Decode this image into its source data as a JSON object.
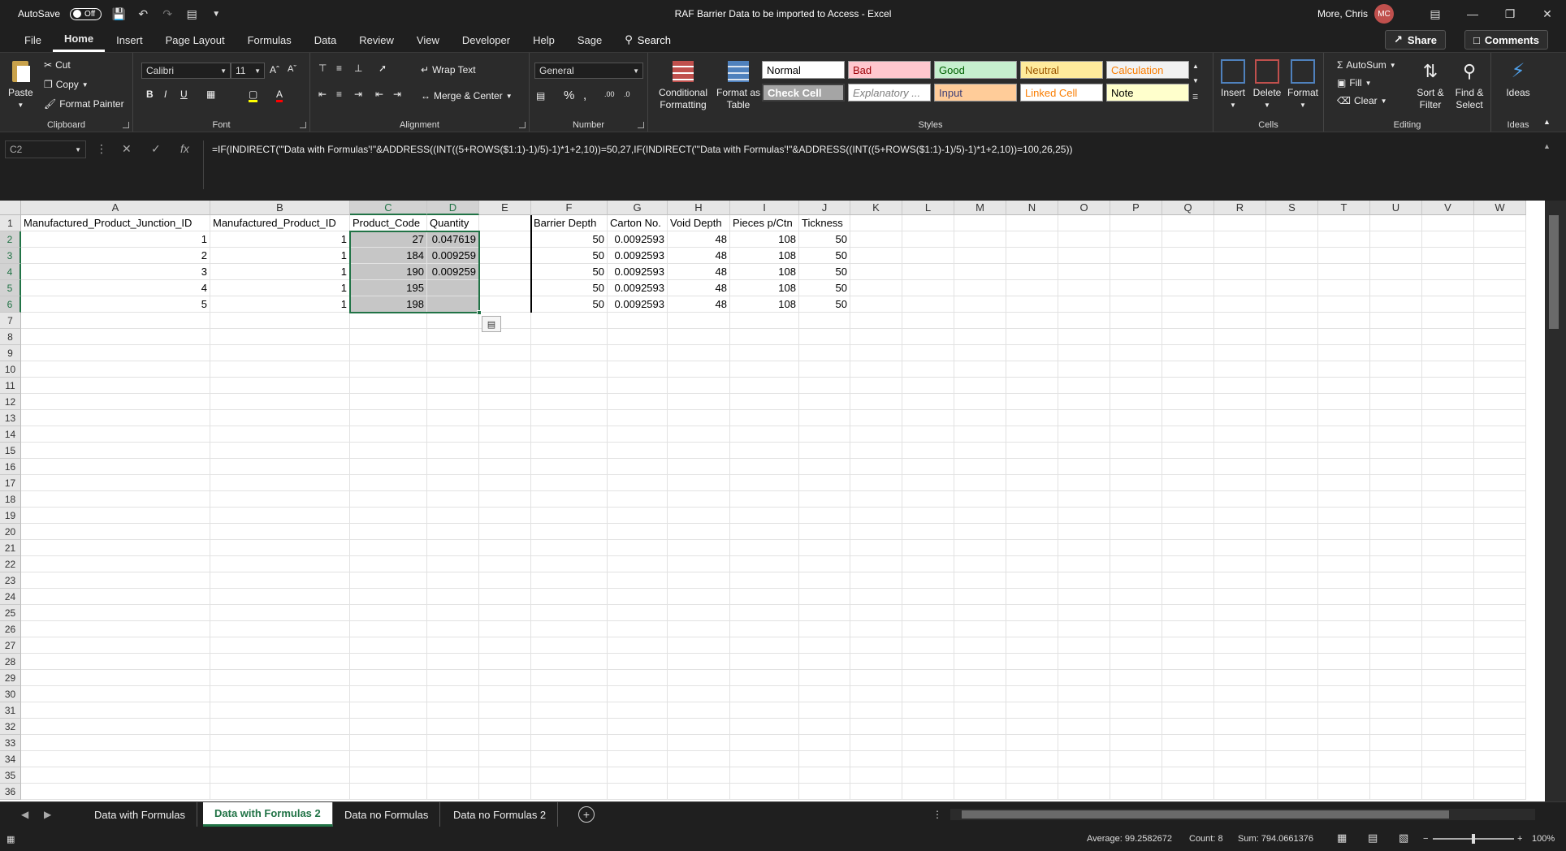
{
  "titlebar": {
    "autosave_label": "AutoSave",
    "autosave_state": "Off",
    "title": "RAF Barrier Data to be imported to Access  -  Excel",
    "user_name": "More, Chris",
    "user_initials": "MC"
  },
  "menu": {
    "tabs": [
      "File",
      "Home",
      "Insert",
      "Page Layout",
      "Formulas",
      "Data",
      "Review",
      "View",
      "Developer",
      "Help",
      "Sage"
    ],
    "search_label": "Search",
    "share_label": "Share",
    "comments_label": "Comments"
  },
  "ribbon": {
    "clipboard": {
      "label": "Clipboard",
      "paste": "Paste",
      "cut": "Cut",
      "copy": "Copy",
      "format_painter": "Format Painter"
    },
    "font": {
      "label": "Font",
      "name": "Calibri",
      "size": "11"
    },
    "alignment": {
      "label": "Alignment",
      "wrap_text": "Wrap Text",
      "merge_center": "Merge & Center"
    },
    "number": {
      "label": "Number",
      "format": "General"
    },
    "styles": {
      "label": "Styles",
      "conditional": "Conditional Formatting",
      "format_table": "Format as Table",
      "cells": [
        {
          "label": "Normal",
          "bg": "#ffffff",
          "fg": "#000000"
        },
        {
          "label": "Bad",
          "bg": "#ffc7ce",
          "fg": "#9c0006"
        },
        {
          "label": "Good",
          "bg": "#c6efce",
          "fg": "#006100"
        },
        {
          "label": "Neutral",
          "bg": "#ffeb9c",
          "fg": "#9c5700"
        },
        {
          "label": "Calculation",
          "bg": "#f2f2f2",
          "fg": "#fa7d00"
        },
        {
          "label": "Check Cell",
          "bg": "#a5a5a5",
          "fg": "#ffffff"
        },
        {
          "label": "Explanatory ...",
          "bg": "#ffffff",
          "fg": "#7f7f7f"
        },
        {
          "label": "Input",
          "bg": "#ffcc99",
          "fg": "#3f3f76"
        },
        {
          "label": "Linked Cell",
          "bg": "#ffffff",
          "fg": "#fa7d00"
        },
        {
          "label": "Note",
          "bg": "#ffffcc",
          "fg": "#000000"
        }
      ]
    },
    "cells": {
      "label": "Cells",
      "insert": "Insert",
      "delete": "Delete",
      "format": "Format"
    },
    "editing": {
      "label": "Editing",
      "autosum": "AutoSum",
      "fill": "Fill",
      "clear": "Clear",
      "sort_filter": "Sort & Filter",
      "find_select": "Find & Select"
    },
    "ideas": {
      "label": "Ideas",
      "button": "Ideas"
    }
  },
  "formula_bar": {
    "name_box": "C2",
    "formula": "=IF(INDIRECT(\"'Data with Formulas'!\"&ADDRESS((INT((5+ROWS($1:1)-1)/5)-1)*1+2,10))=50,27,IF(INDIRECT(\"'Data with Formulas'!\"&ADDRESS((INT((5+ROWS($1:1)-1)/5)-1)*1+2,10))=100,26,25))"
  },
  "grid": {
    "columns": [
      "A",
      "B",
      "C",
      "D",
      "E",
      "F",
      "G",
      "H",
      "I",
      "J",
      "K",
      "L",
      "M",
      "N",
      "O",
      "P",
      "Q",
      "R",
      "S",
      "T",
      "U",
      "V",
      "W"
    ],
    "row_count": 36,
    "headers_row": [
      "Manufactured_Product_Junction_ID",
      "Manufactured_Product_ID",
      "Product_Code",
      "Quantity",
      "",
      "Barrier  Depth",
      "Carton No.",
      "Void Depth",
      "Pieces p/Ctn",
      "Tickness"
    ],
    "rows": [
      [
        "1",
        "1",
        "27",
        "0.047619",
        "",
        "50",
        "0.0092593",
        "48",
        "108",
        "50"
      ],
      [
        "2",
        "1",
        "184",
        "0.009259",
        "",
        "50",
        "0.0092593",
        "48",
        "108",
        "50"
      ],
      [
        "3",
        "1",
        "190",
        "0.009259",
        "",
        "50",
        "0.0092593",
        "48",
        "108",
        "50"
      ],
      [
        "4",
        "1",
        "195",
        "",
        "",
        "50",
        "0.0092593",
        "48",
        "108",
        "50"
      ],
      [
        "5",
        "1",
        "198",
        "",
        "",
        "50",
        "0.0092593",
        "48",
        "108",
        "50"
      ]
    ]
  },
  "sheets": {
    "tabs": [
      "Data with Formulas",
      "Data with Formulas 2",
      "Data no Formulas",
      "Data no Formulas 2"
    ],
    "active_index": 1
  },
  "status": {
    "average": "Average: 99.2582672",
    "count": "Count: 8",
    "sum": "Sum: 794.0661376",
    "zoom": "100%"
  }
}
